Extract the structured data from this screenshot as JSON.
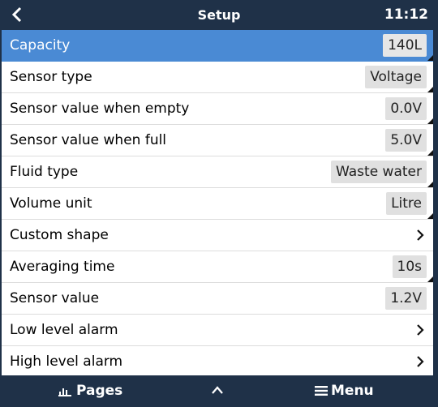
{
  "header": {
    "title": "Setup",
    "time": "11:12"
  },
  "rows": [
    {
      "label": "Capacity",
      "value": "140L"
    },
    {
      "label": "Sensor type",
      "value": "Voltage"
    },
    {
      "label": "Sensor value when empty",
      "value": "0.0V"
    },
    {
      "label": "Sensor value when full",
      "value": "5.0V"
    },
    {
      "label": "Fluid type",
      "value": "Waste water"
    },
    {
      "label": "Volume unit",
      "value": "Litre"
    },
    {
      "label": "Custom shape"
    },
    {
      "label": "Averaging time",
      "value": "10s"
    },
    {
      "label": "Sensor value",
      "value": "1.2V"
    },
    {
      "label": "Low level alarm"
    },
    {
      "label": "High level alarm"
    }
  ],
  "footer": {
    "pages_label": "Pages",
    "menu_label": "Menu"
  },
  "colors": {
    "background": "#1f3148",
    "selected_row": "#4a8ad4",
    "value_box": "#e0e0e0"
  },
  "icons": {
    "back": "back-arrow-icon",
    "submenu": "chevron-right-icon",
    "pages": "bar-chart-icon",
    "up": "chevron-up-icon",
    "menu": "hamburger-icon"
  }
}
